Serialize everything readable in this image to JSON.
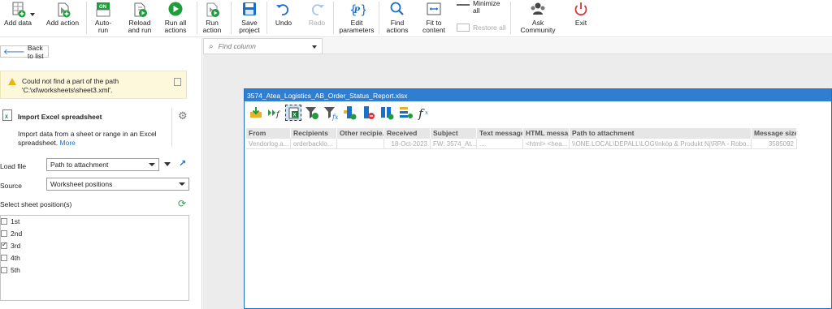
{
  "ribbon": {
    "add_data": "Add data",
    "add_action": "Add action",
    "auto_run": "Auto-\nrun",
    "reload_and_run": "Reload\nand run",
    "run_all_actions": "Run all\nactions",
    "run_action": "Run\naction",
    "save_project": "Save\nproject",
    "undo": "Undo",
    "redo": "Redo",
    "edit_parameters": "Edit\nparameters",
    "find_actions": "Find\nactions",
    "fit_to_content": "Fit to\ncontent",
    "minimize_all": "Minimize\nall",
    "restore_all": "Restore all",
    "ask_community": "Ask\nCommunity",
    "exit": "Exit",
    "auto_run_badge": "ON"
  },
  "left": {
    "back_to_list": "Back to list",
    "warning": "Could not find a part of the path 'C:\\xl\\worksheets\\sheet3.xml'.",
    "step_title": "Import Excel spreadsheet",
    "step_desc": "Import data from a sheet or range in an Excel spreadsheet.",
    "more_link": "More",
    "load_file_label": "Load file",
    "load_file_value": "Path to attachment",
    "source_label": "Source",
    "source_value": "Worksheet positions",
    "select_sheet_label": "Select sheet position(s)",
    "sheets": [
      {
        "label": "1st",
        "checked": false
      },
      {
        "label": "2nd",
        "checked": false
      },
      {
        "label": "3rd",
        "checked": true
      },
      {
        "label": "4th",
        "checked": false
      },
      {
        "label": "5th",
        "checked": false
      }
    ]
  },
  "right": {
    "find_column_placeholder": "Find column",
    "sheet_title": "3574_Atea_Logistics_AB_Order_Status_Report.xlsx",
    "columns": [
      "From",
      "Recipients",
      "Other recipie...",
      "Received",
      "Subject",
      "Text message",
      "HTML messa...",
      "Path to attachment",
      "Message size"
    ],
    "row": [
      "Vendorlog.a...",
      "orderbacklo...",
      "",
      "18-Oct-2023",
      "FW: 3574_At...",
      "...",
      "<html> <hea...",
      "\\\\ONE.LOCAL\\DEPALL\\LOG\\Inköp & Produkt Nj\\RPA - Robo...",
      "3585092"
    ]
  },
  "colors": {
    "accent_blue": "#2f7ed2",
    "run_green": "#1f9d3a",
    "warning_bg": "#fdf7dc",
    "exit_red": "#d9343a"
  }
}
